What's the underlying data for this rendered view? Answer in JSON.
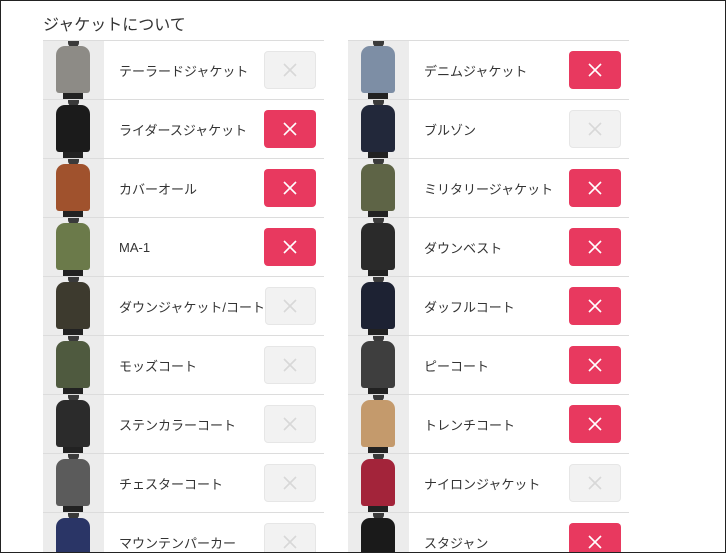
{
  "section": {
    "title": "ジャケットについて"
  },
  "colors": {
    "selected": "#e8395f",
    "unselected": "#f2f2f2"
  },
  "left": [
    {
      "label": "テーラードジャケット",
      "selected": false,
      "color": "#8d8b86",
      "icon": "tailored-jacket-icon"
    },
    {
      "label": "ライダースジャケット",
      "selected": true,
      "color": "#1b1b1b",
      "icon": "riders-jacket-icon"
    },
    {
      "label": "カバーオール",
      "selected": true,
      "color": "#a0522d",
      "icon": "coverall-icon"
    },
    {
      "label": "MA-1",
      "selected": true,
      "color": "#6b7a4a",
      "icon": "ma1-jacket-icon"
    },
    {
      "label": "ダウンジャケット/コート",
      "selected": false,
      "color": "#3d3a2e",
      "icon": "down-jacket-icon"
    },
    {
      "label": "モッズコート",
      "selected": false,
      "color": "#4f5a3f",
      "icon": "mods-coat-icon"
    },
    {
      "label": "ステンカラーコート",
      "selected": false,
      "color": "#2b2b2b",
      "icon": "stand-collar-coat-icon"
    },
    {
      "label": "チェスターコート",
      "selected": false,
      "color": "#5b5b5b",
      "icon": "chester-coat-icon"
    },
    {
      "label": "マウンテンパーカー",
      "selected": false,
      "color": "#2a3566",
      "icon": "mountain-parka-icon"
    }
  ],
  "right": [
    {
      "label": "デニムジャケット",
      "selected": true,
      "color": "#7d8ea5",
      "icon": "denim-jacket-icon"
    },
    {
      "label": "ブルゾン",
      "selected": false,
      "color": "#22283a",
      "icon": "blouson-icon"
    },
    {
      "label": "ミリタリージャケット",
      "selected": true,
      "color": "#5e6446",
      "icon": "military-jacket-icon"
    },
    {
      "label": "ダウンベスト",
      "selected": true,
      "color": "#2a2a2a",
      "icon": "down-vest-icon"
    },
    {
      "label": "ダッフルコート",
      "selected": true,
      "color": "#1d2233",
      "icon": "duffle-coat-icon"
    },
    {
      "label": "ピーコート",
      "selected": true,
      "color": "#3e3e3e",
      "icon": "pea-coat-icon"
    },
    {
      "label": "トレンチコート",
      "selected": true,
      "color": "#c49a6c",
      "icon": "trench-coat-icon"
    },
    {
      "label": "ナイロンジャケット",
      "selected": false,
      "color": "#a3243a",
      "icon": "nylon-jacket-icon"
    },
    {
      "label": "スタジャン",
      "selected": true,
      "color": "#1a1a1a",
      "icon": "stadium-jacket-icon"
    }
  ]
}
